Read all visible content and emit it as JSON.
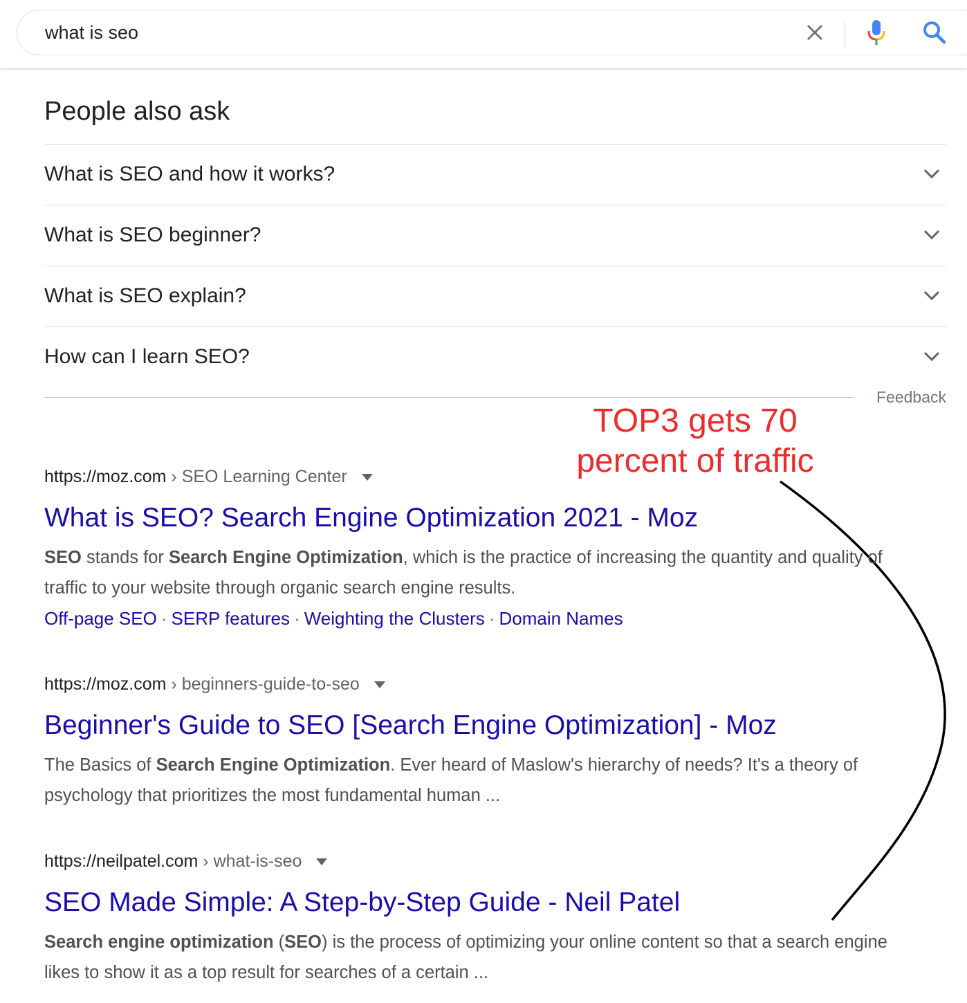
{
  "search": {
    "query": "what is seo",
    "clear_icon": "close-icon",
    "mic_icon": "microphone-icon",
    "search_icon": "magnifier-icon"
  },
  "paa": {
    "title": "People also ask",
    "questions": [
      "What is SEO and how it works?",
      "What is SEO beginner?",
      "What is SEO explain?",
      "How can I learn SEO?"
    ],
    "feedback": "Feedback"
  },
  "annotation": {
    "line1": "TOP3 gets 70",
    "line2": "percent of traffic",
    "color": "#ee2b2b"
  },
  "results": [
    {
      "domain": "https://moz.com",
      "breadcrumb": "SEO Learning Center",
      "title": "What is SEO? Search Engine Optimization 2021 - Moz",
      "snippet_parts": [
        {
          "t": "SEO",
          "b": true
        },
        {
          "t": " stands for ",
          "b": false
        },
        {
          "t": "Search Engine Optimization",
          "b": true
        },
        {
          "t": ", which is the practice of increasing the quantity and quality of traffic to your website through organic search engine results.",
          "b": false
        }
      ],
      "sitelinks": [
        "Off-page SEO",
        "SERP features",
        "Weighting the Clusters",
        "Domain Names"
      ]
    },
    {
      "domain": "https://moz.com",
      "breadcrumb": "beginners-guide-to-seo",
      "title": "Beginner's Guide to SEO [Search Engine Optimization] - Moz",
      "snippet_parts": [
        {
          "t": "The Basics of ",
          "b": false
        },
        {
          "t": "Search Engine Optimization",
          "b": true
        },
        {
          "t": ". Ever heard of Maslow's hierarchy of needs? It's a theory of psychology that prioritizes the most fundamental human ...",
          "b": false
        }
      ],
      "sitelinks": []
    },
    {
      "domain": "https://neilpatel.com",
      "breadcrumb": "what-is-seo",
      "title": "SEO Made Simple: A Step-by-Step Guide - Neil Patel",
      "snippet_parts": [
        {
          "t": "Search engine optimization",
          "b": true
        },
        {
          "t": " (",
          "b": false
        },
        {
          "t": "SEO",
          "b": true
        },
        {
          "t": ") is the process of optimizing your online content so that a search engine likes to show it as a top result for searches of a certain ...",
          "b": false
        }
      ],
      "sitelinks": []
    }
  ],
  "colors": {
    "link": "#1a0dab",
    "snippet": "#4d5156",
    "breadcrumb": "#5f6368",
    "accent_blue": "#4285f4"
  }
}
